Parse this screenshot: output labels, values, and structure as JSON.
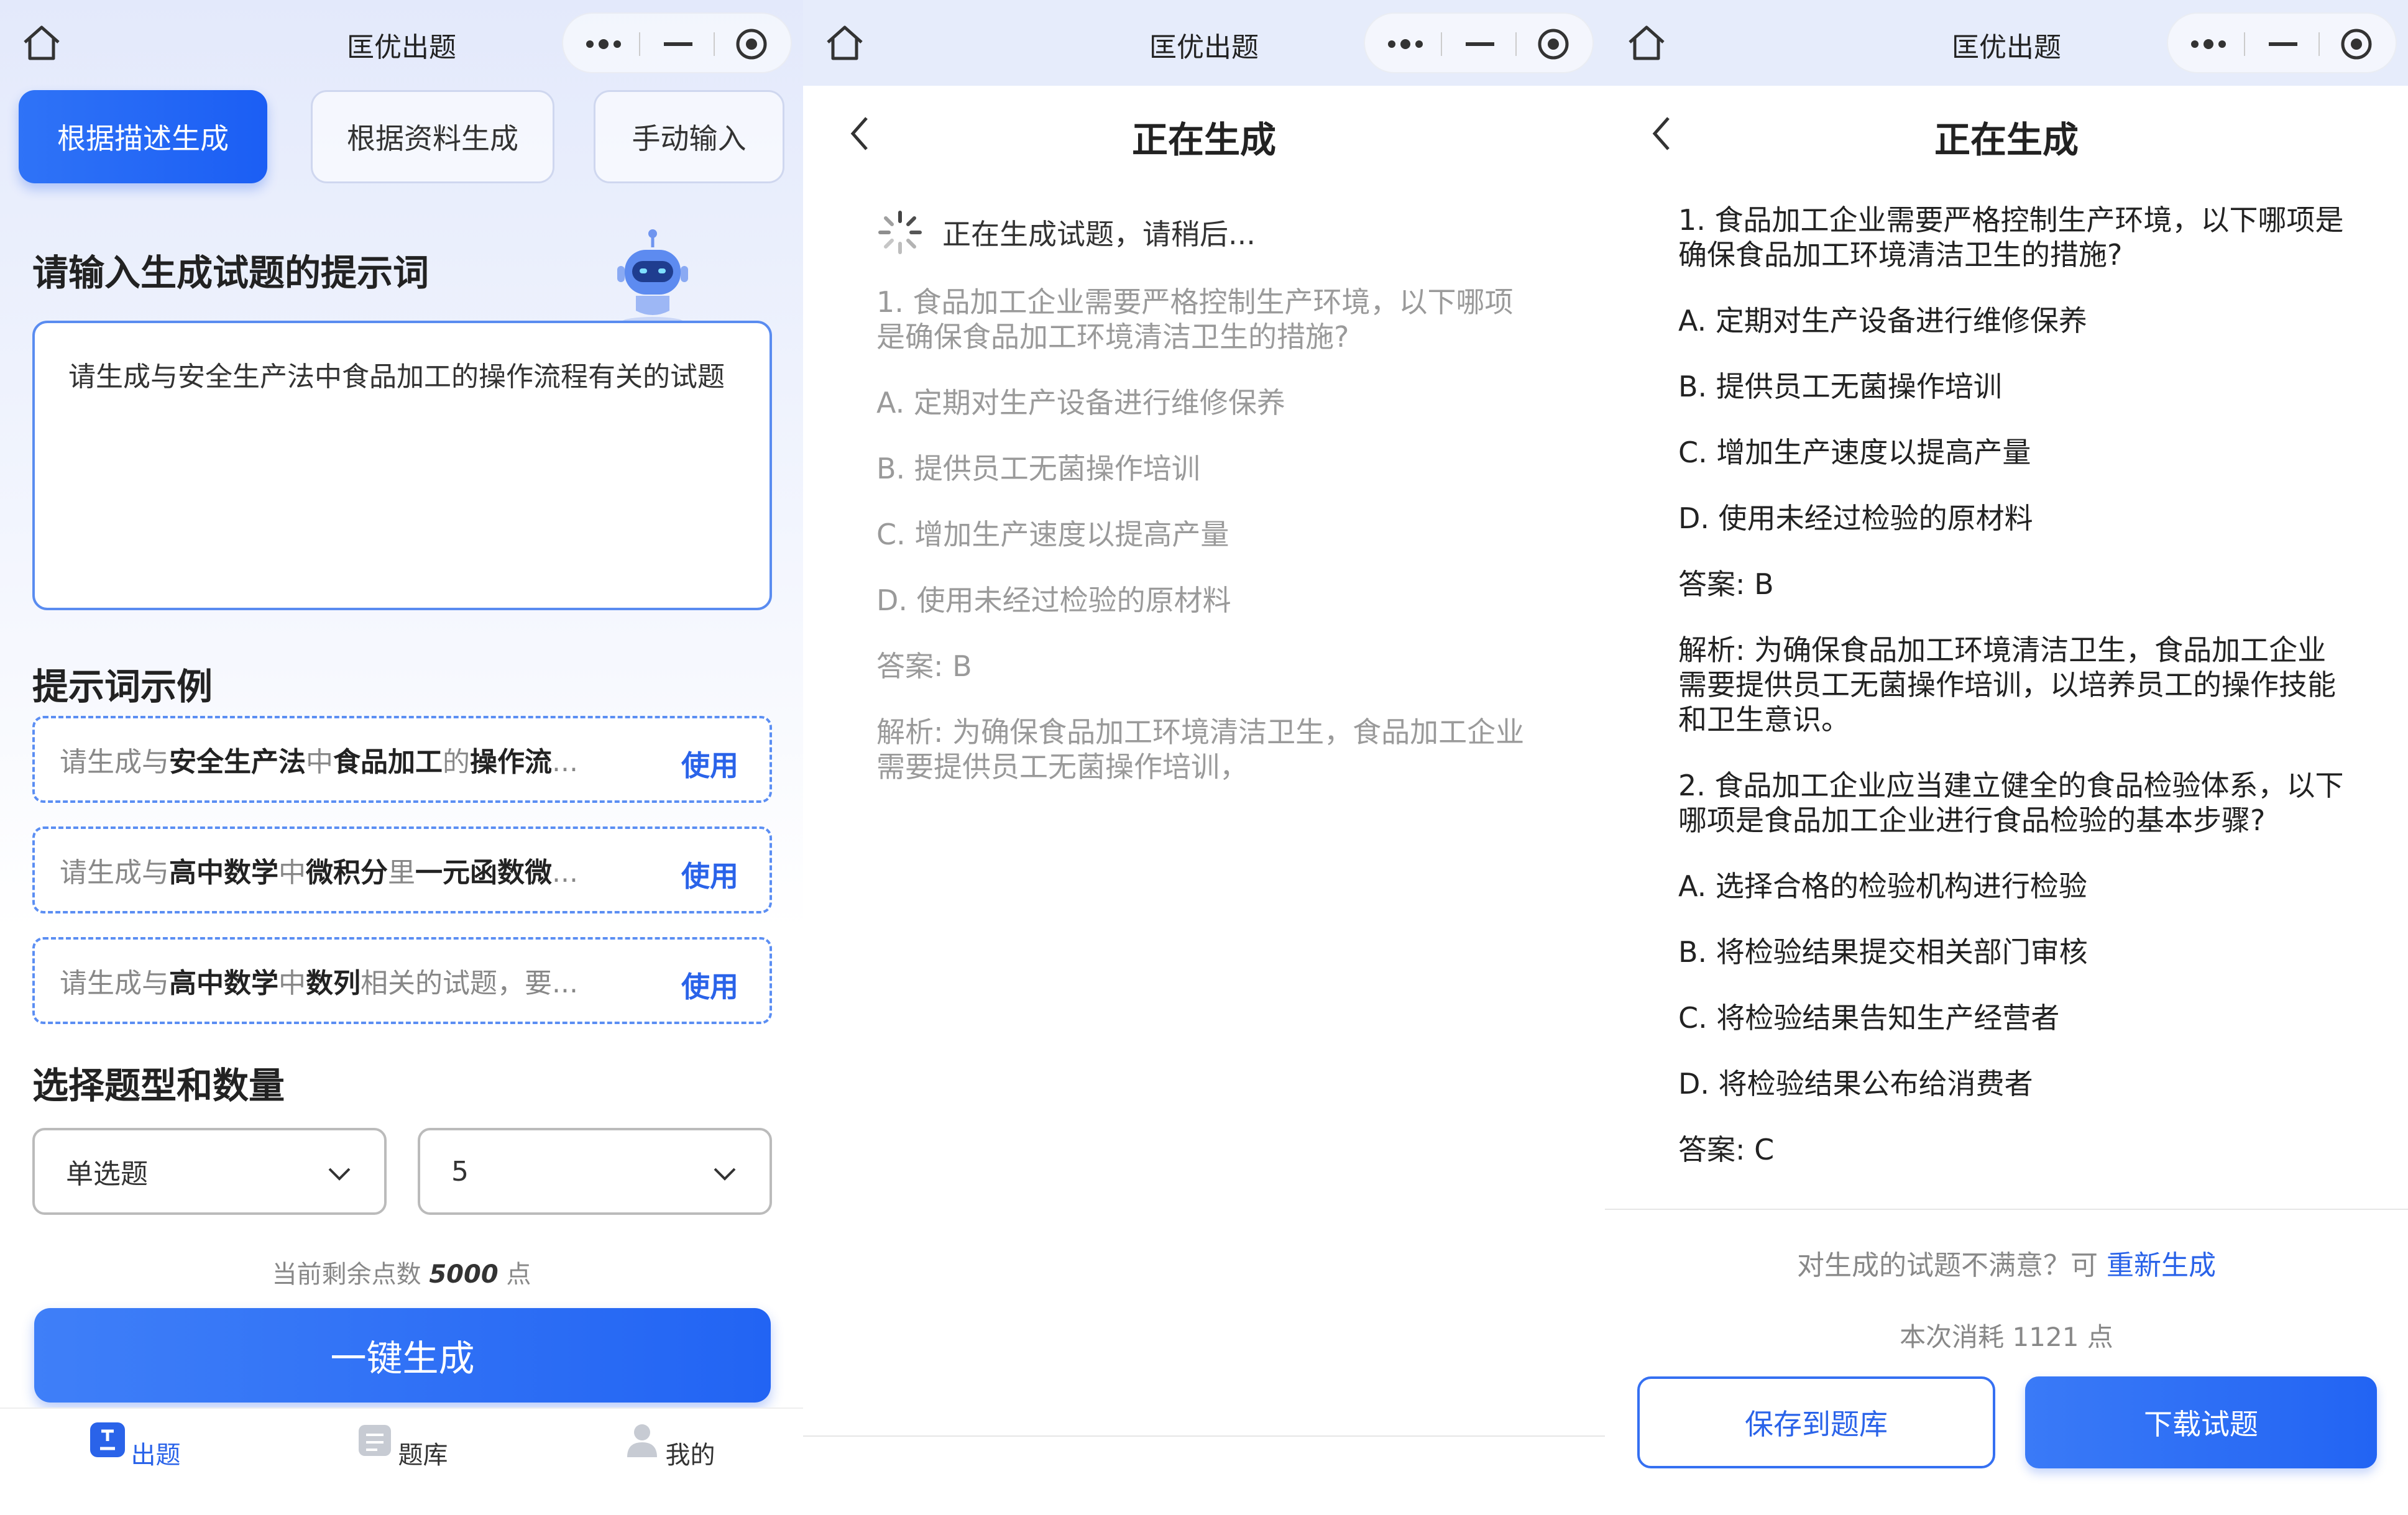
{
  "app_title": "匡优出题",
  "screen1": {
    "tabs": [
      "根据描述生成",
      "根据资料生成",
      "手动输入"
    ],
    "prompt_heading": "请输入生成试题的提示词",
    "prompt_value": "请生成与安全生产法中食品加工的操作流程有关的试题",
    "examples_heading": "提示词示例",
    "examples": [
      {
        "segments": [
          "请生成与",
          "安全生产法",
          "中",
          "食品加工",
          "的",
          "操作流",
          "..."
        ],
        "use": "使用"
      },
      {
        "segments": [
          "请生成与",
          "高中数学",
          "中",
          "微积分",
          "里",
          "一元函数微",
          "..."
        ],
        "use": "使用"
      },
      {
        "segments": [
          "请生成与",
          "高中数学",
          "中",
          "数列",
          "相关的试题，要",
          "",
          "..."
        ],
        "use": "使用"
      }
    ],
    "type_heading": "选择题型和数量",
    "type_select": "单选题",
    "count_select": "5",
    "points_prefix": "当前剩余点数",
    "points_value": "5000",
    "points_suffix": "点",
    "generate_button": "一键生成",
    "tabbar": [
      "出题",
      "题库",
      "我的"
    ]
  },
  "screen2": {
    "title": "正在生成",
    "loading_text": "正在生成试题，请稍后...",
    "lines": [
      "1. 食品加工企业需要严格控制生产环境，以下哪项是确保食品加工环境清洁卫生的措施?",
      "A. 定期对生产设备进行维修保养",
      "B. 提供员工无菌操作培训",
      "C. 增加生产速度以提高产量",
      "D. 使用未经过检验的原材料",
      "答案: B",
      "解析: 为确保食品加工环境清洁卫生，食品加工企业需要提供员工无菌操作培训，"
    ]
  },
  "screen3": {
    "title": "正在生成",
    "lines": [
      "1. 食品加工企业需要严格控制生产环境，以下哪项是确保食品加工环境清洁卫生的措施?",
      "A. 定期对生产设备进行维修保养",
      "B. 提供员工无菌操作培训",
      "C. 增加生产速度以提高产量",
      "D. 使用未经过检验的原材料",
      "答案: B",
      "解析: 为确保食品加工环境清洁卫生，食品加工企业需要提供员工无菌操作培训，以培养员工的操作技能和卫生意识。",
      "2. 食品加工企业应当建立健全的食品检验体系，以下哪项是食品加工企业进行食品检验的基本步骤?",
      "A. 选择合格的检验机构进行检验",
      "B. 将检验结果提交相关部门审核",
      "C. 将检验结果告知生产经营者",
      "D. 将检验结果公布给消费者",
      "答案: C"
    ],
    "regen_prefix": "对生成的试题不满意？可",
    "regen_link": "重新生成",
    "cost_prefix": "本次消耗",
    "cost_value": "1121",
    "cost_suffix": "点",
    "save_button": "保存到题库",
    "download_button": "下载试题"
  },
  "colors": {
    "accent": "#2264f3",
    "link": "#2a63e9"
  }
}
